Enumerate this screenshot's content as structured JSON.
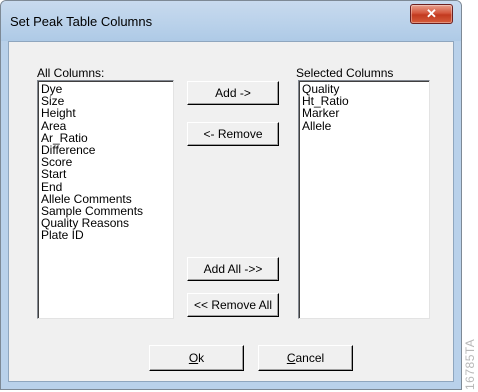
{
  "window": {
    "title": "Set Peak Table Columns",
    "close_glyph": "✕"
  },
  "all_columns": {
    "label": "All Columns:",
    "items": [
      "Dye",
      "Size",
      "Height",
      "Area",
      "Ar_Ratio",
      "Difference",
      "Score",
      "Start",
      "End",
      "Allele Comments",
      "Sample Comments",
      "Quality Reasons",
      "Plate ID"
    ]
  },
  "selected_columns": {
    "label": "Selected Columns",
    "items": [
      "Quality",
      "Ht_Ratio",
      "Marker",
      "Allele"
    ]
  },
  "buttons": {
    "add": "Add ->",
    "remove": "<- Remove",
    "add_all": "Add All ->>",
    "remove_all": "<< Remove All",
    "ok_mnemonic": "O",
    "ok_rest": "k",
    "cancel_mnemonic": "C",
    "cancel_rest": "ancel"
  },
  "watermark": "16785TA"
}
